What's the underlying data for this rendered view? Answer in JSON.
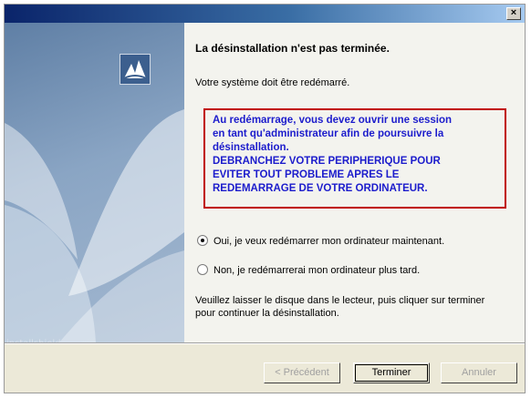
{
  "window": {
    "close_label": "×"
  },
  "left_panel": {
    "watermark": "installshield"
  },
  "main": {
    "heading": "La désinstallation n'est pas terminée.",
    "subtitle": "Votre système doit être redémarré.",
    "warning_lines": [
      "Au redémarrage, vous devez ouvrir une session",
      "en tant qu'administrateur afin de poursuivre la",
      "désinstallation.",
      "DEBRANCHEZ VOTRE PERIPHERIQUE POUR",
      "EVITER TOUT PROBLEME APRES LE",
      "REDEMARRAGE DE VOTRE ORDINATEUR."
    ],
    "options": [
      {
        "label": "Oui, je veux redémarrer mon ordinateur maintenant.",
        "selected": true
      },
      {
        "label": "Non, je redémarrerai mon ordinateur plus tard.",
        "selected": false
      }
    ],
    "instruction": "Veuillez laisser le disque dans le lecteur, puis cliquer sur terminer pour continuer la désinstallation."
  },
  "buttons": {
    "previous": "< Précédent",
    "finish": "Terminer",
    "cancel": "Annuler"
  },
  "colors": {
    "warning_text": "#1c1ccc",
    "warning_border": "#c00000"
  }
}
